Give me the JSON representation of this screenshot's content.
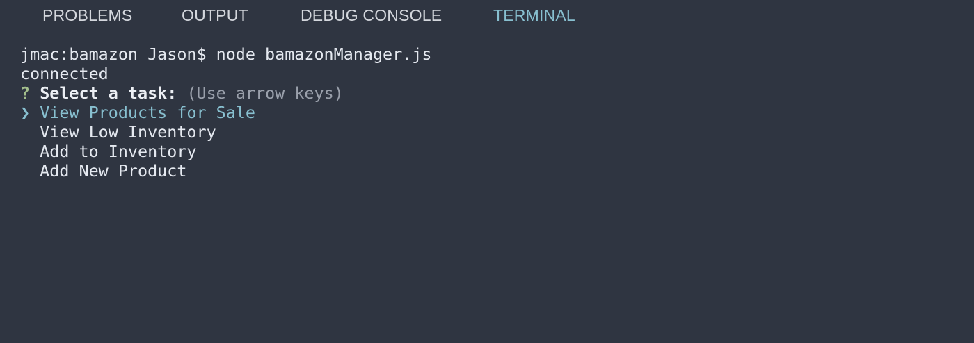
{
  "tabs": [
    {
      "label": "PROBLEMS",
      "active": false
    },
    {
      "label": "OUTPUT",
      "active": false
    },
    {
      "label": "DEBUG CONSOLE",
      "active": false
    },
    {
      "label": "TERMINAL",
      "active": true
    }
  ],
  "terminal": {
    "command_line": "jmac:bamazon Jason$ node bamazonManager.js",
    "output_line": "connected",
    "prompt": {
      "question_mark": "?",
      "question": "Select a task:",
      "hint": "(Use arrow keys)"
    },
    "pointer": "❯",
    "options": [
      "View Products for Sale",
      "View Low Inventory",
      "Add to Inventory",
      "Add New Product"
    ],
    "selected_index": 0
  },
  "colors": {
    "background": "#2f3541",
    "text": "#e5e9f0",
    "accent": "#88c0d0",
    "question_mark": "#a3be8c",
    "hint": "#9aa0ab"
  }
}
